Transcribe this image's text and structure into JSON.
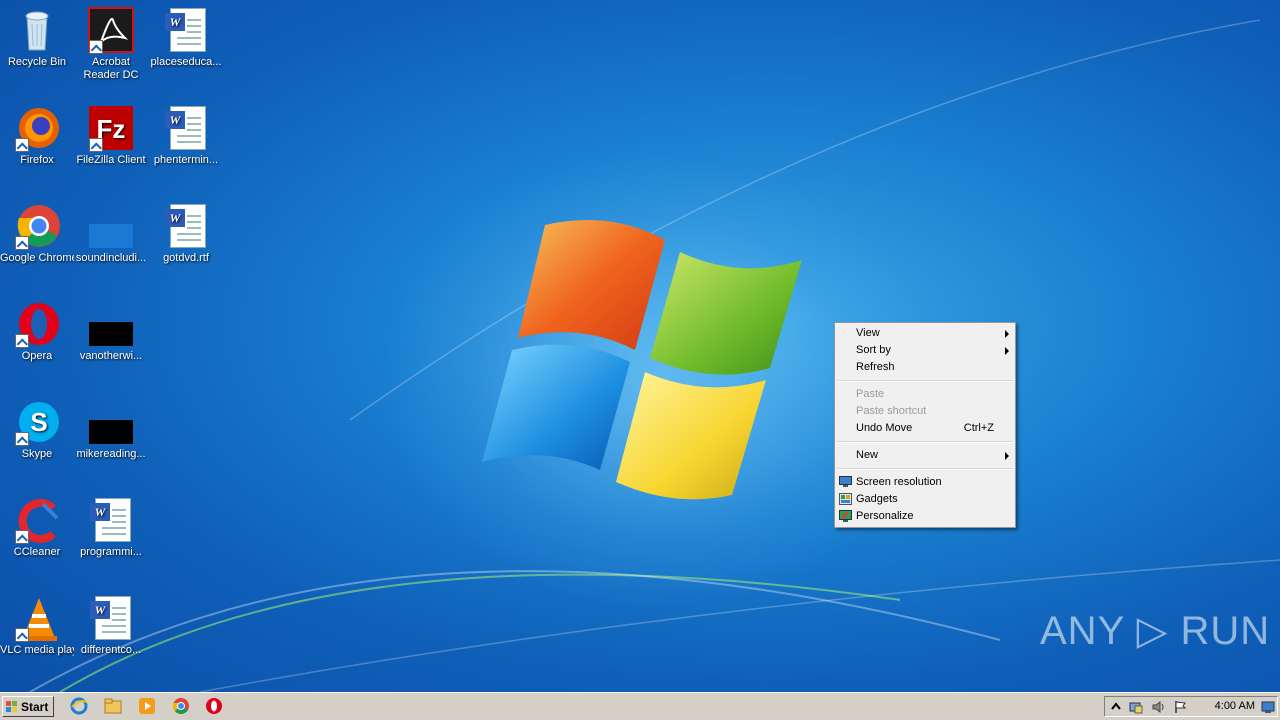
{
  "desktop_icons": [
    {
      "label": "Recycle Bin",
      "icon": "recycle-bin-icon"
    },
    {
      "label": "Acrobat Reader DC",
      "icon": "acrobat-icon"
    },
    {
      "label": "placeseduca...",
      "icon": "word-document-icon"
    },
    {
      "label": "Firefox",
      "icon": "firefox-icon"
    },
    {
      "label": "FileZilla Client",
      "icon": "filezilla-icon"
    },
    {
      "label": "phentermin...",
      "icon": "word-document-icon"
    },
    {
      "label": "Google Chrome",
      "icon": "chrome-icon"
    },
    {
      "label": "soundincludi...",
      "icon": "blank-file-icon"
    },
    {
      "label": "gotdvd.rtf",
      "icon": "word-document-icon"
    },
    {
      "label": "Opera",
      "icon": "opera-icon"
    },
    {
      "label": "vanotherwi...",
      "icon": "black-file-icon"
    },
    {
      "label": "Skype",
      "icon": "skype-icon"
    },
    {
      "label": "mikereading...",
      "icon": "black-file-icon"
    },
    {
      "label": "CCleaner",
      "icon": "ccleaner-icon"
    },
    {
      "label": "programmi...",
      "icon": "word-document-icon"
    },
    {
      "label": "VLC media player",
      "icon": "vlc-icon"
    },
    {
      "label": "differentco...",
      "icon": "word-document-icon"
    }
  ],
  "context_menu": {
    "view": "View",
    "sort_by": "Sort by",
    "refresh": "Refresh",
    "paste": "Paste",
    "paste_shortcut": "Paste shortcut",
    "undo_move": "Undo Move",
    "undo_move_shortcut": "Ctrl+Z",
    "new": "New",
    "screen_resolution": "Screen resolution",
    "gadgets": "Gadgets",
    "personalize": "Personalize"
  },
  "watermark": "ANY ▷ RUN",
  "taskbar": {
    "start_label": "Start",
    "clock": "4:00 AM"
  }
}
